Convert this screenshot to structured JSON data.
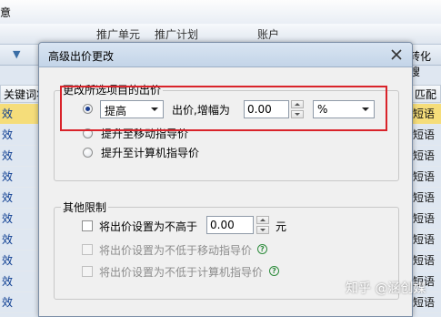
{
  "background": {
    "topbar_left_text": "意",
    "tabs": [
      "推广单元",
      "推广计划",
      "账户"
    ],
    "toolbar_right_text": "转化搜",
    "column_header_left": "关键词状态",
    "column_header_right": "匹配",
    "left_rows": [
      "效",
      "效",
      "效",
      "效",
      "效",
      "效",
      "效",
      "效",
      "效",
      "效"
    ],
    "right_rows": [
      "短语",
      "短语",
      "短语",
      "短语",
      "短语",
      "短语",
      "短语",
      "短语",
      "短语",
      "短语"
    ]
  },
  "dialog": {
    "title": "高级出价更改",
    "change_group": {
      "legend": "更改所选项目的出价",
      "option_raise": {
        "combo_value": "提高",
        "label": "出价,增幅为",
        "amount_value": "0.00",
        "unit_value": "%"
      },
      "option_mobile_label": "提升至移动指导价",
      "option_computer_label": "提升至计算机指导价",
      "selected_option": "raise"
    },
    "other_group": {
      "legend": "其他限制",
      "max_bid_label": "将出价设置为不高于",
      "max_bid_value": "0.00",
      "max_bid_unit": "元",
      "min_mobile_label": "将出价设置为不低于移动指导价",
      "min_computer_label": "将出价设置为不低于计算机指导价"
    }
  },
  "watermark": "知乎 @涵创媒",
  "colors": {
    "highlight": "#d9232a",
    "selected_row": "#f5dd7a",
    "dialog_title_bg": "#c3d4e8"
  }
}
